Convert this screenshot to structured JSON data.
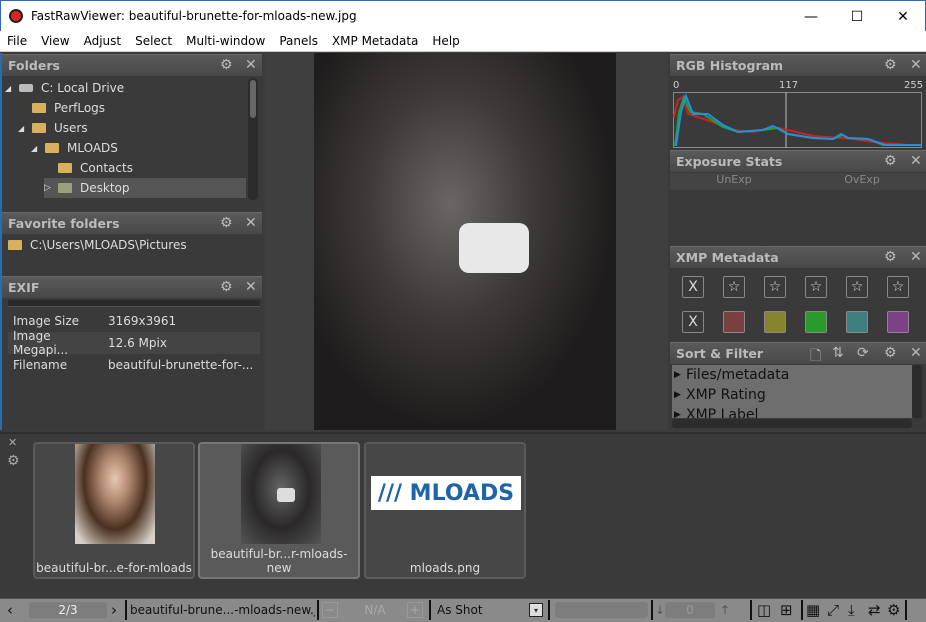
{
  "window": {
    "title": "FastRawViewer: beautiful-brunette-for-mloads-new.jpg",
    "controls": [
      "—",
      "☐",
      "✕"
    ]
  },
  "menu": [
    "File",
    "View",
    "Adjust",
    "Select",
    "Multi-window",
    "Panels",
    "XMP Metadata",
    "Help"
  ],
  "folders": {
    "title": "Folders",
    "items": [
      {
        "label": "C: Local Drive",
        "expander": "◢"
      },
      {
        "label": "PerfLogs",
        "expander": ""
      },
      {
        "label": "Users",
        "expander": "◢"
      },
      {
        "label": "MLOADS",
        "expander": "◢"
      },
      {
        "label": "Contacts",
        "expander": ""
      },
      {
        "label": "Desktop",
        "expander": "▷",
        "selected": true
      }
    ]
  },
  "favorites": {
    "title": "Favorite folders",
    "items": [
      "C:\\Users\\MLOADS\\Pictures"
    ]
  },
  "exif": {
    "title": "EXIF",
    "rows": [
      [
        "Image Size",
        "3169x3961"
      ],
      [
        "Image Megapi...",
        "12.6 Mpix"
      ],
      [
        "Filename",
        "beautiful-brunette-for-..."
      ]
    ]
  },
  "histogram": {
    "title": "RGB Histogram",
    "ticks": [
      "0",
      "117",
      "255"
    ],
    "colors": {
      "red": "#d02020",
      "green": "#20a030",
      "blue": "#2090e0"
    }
  },
  "exposure": {
    "title": "Exposure Stats",
    "cols": [
      "UnExp",
      "OvExp"
    ]
  },
  "xmp": {
    "title": "XMP Metadata",
    "reject": "X",
    "star": "☆",
    "labels": [
      "#7a3f3f",
      "#85852e",
      "#2a9a2a",
      "#3f7f7f",
      "#7d3f86"
    ]
  },
  "sortfilter": {
    "title": "Sort & Filter",
    "items": [
      "Files/metadata",
      "XMP Rating",
      "XMP Label"
    ]
  },
  "thumbnails": [
    {
      "caption": "beautiful-br...e-for-mloads"
    },
    {
      "caption": "beautiful-br...r-mloads-new",
      "selected": true
    },
    {
      "caption": "mloads.png",
      "logo": "/// MLOADS"
    }
  ],
  "statusbar": {
    "page": "2/3",
    "filename": "beautiful-brune...-mloads-new.jpg",
    "minus": "−",
    "na": "N/A",
    "plus": "+",
    "wb": "As Shot",
    "counter": "0"
  }
}
